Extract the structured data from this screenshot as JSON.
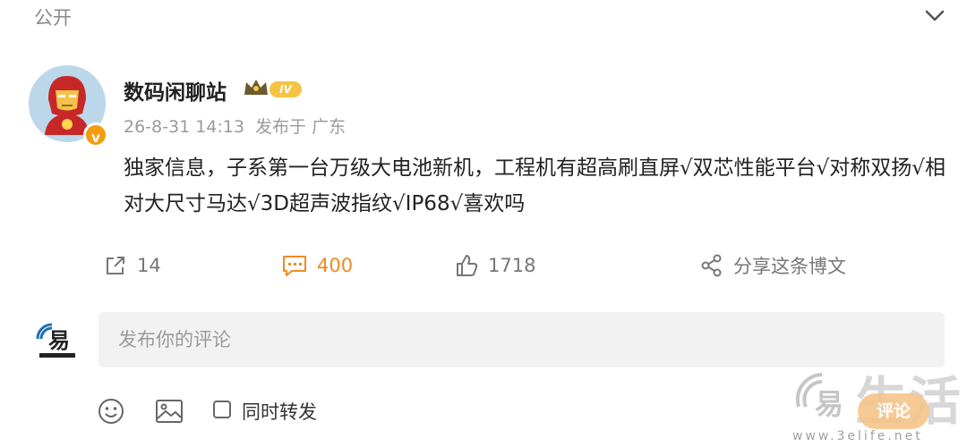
{
  "topbar": {
    "visibility_label": "公开",
    "collapse_icon": "chevron-down-icon"
  },
  "post": {
    "author_name": "数码闲聊站",
    "level_badge": "IV",
    "verified_badge": "v",
    "timestamp": "26-8-31 14:13",
    "location": "发布于 广东",
    "text": "独家信息，子系第一台万级大电池新机，工程机有超高刷直屏√双芯性能平台√对称双扬√相对大尺寸马达√3D超声波指纹√IP68√喜欢吗",
    "actions": {
      "repost_count": "14",
      "comment_count": "400",
      "like_count": "1718",
      "share_label": "分享这条博文"
    }
  },
  "comment_composer": {
    "placeholder": "发布你的评论",
    "repost_checkbox_label": "同时转发",
    "checked": false
  },
  "watermark": {
    "site_text": "生活",
    "button_text": "评论",
    "url": "www.3elife.net"
  },
  "colors": {
    "accent": "#f08a24",
    "muted": "#9a9a9a",
    "input_bg": "#f2f2f2"
  }
}
